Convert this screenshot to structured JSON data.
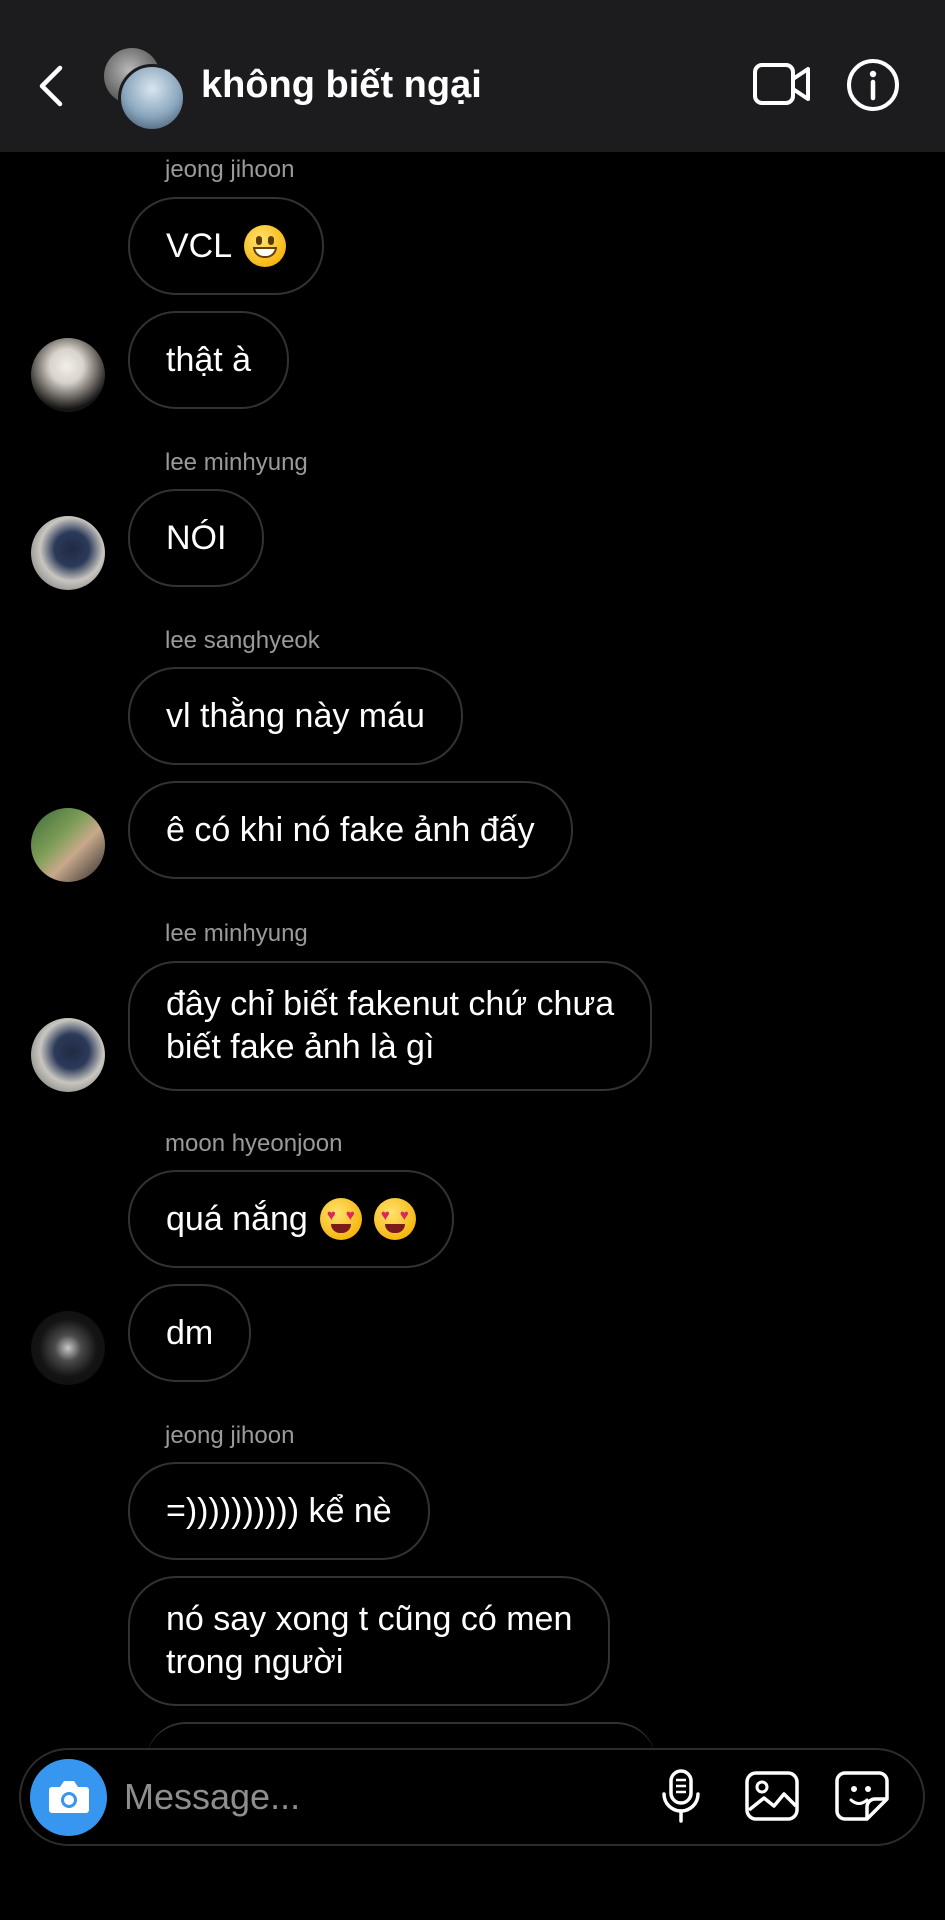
{
  "header": {
    "title": "không biết ngại"
  },
  "messages": [
    {
      "sender": "jeong jihoon",
      "text": "VCL",
      "emoji": "grinning-face-emoji"
    },
    {
      "text": "thật à"
    },
    {
      "sender": "lee minhyung",
      "text": "NÓI"
    },
    {
      "sender": "lee sanghyeok",
      "text": "vl thằng này máu"
    },
    {
      "text": "ê có khi nó fake ảnh đấy"
    },
    {
      "sender": "lee minhyung",
      "text": "đây chỉ biết fakenut chứ chưa\nbiết fake ảnh là gì"
    },
    {
      "sender": "moon hyeonjoon",
      "text": "quá nắng",
      "emoji": "heart-eyes-emoji"
    },
    {
      "text": "dm"
    },
    {
      "sender": "jeong jihoon",
      "text": "=)))))))))) kể nè"
    },
    {
      "text": "nó say xong t cũng có men\ntrong người"
    }
  ],
  "composer": {
    "placeholder": "Message..."
  },
  "colors": {
    "background": "#000000",
    "header": "#1c1c1e",
    "bubble_border": "#323232",
    "sender_label": "#9a9a9a",
    "camera_button": "#3797f0"
  }
}
